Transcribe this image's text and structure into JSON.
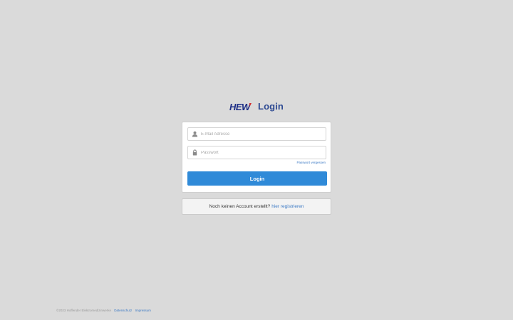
{
  "header": {
    "logo_text": "HEW",
    "title": "Login"
  },
  "login_form": {
    "email": {
      "placeholder": "E-Mail Adresse",
      "value": "",
      "icon": "user-icon"
    },
    "password": {
      "placeholder": "Passwort",
      "value": "",
      "icon": "lock-icon"
    },
    "forgot_link": "Passwort vergessen",
    "submit_label": "Login"
  },
  "register": {
    "prompt": "Noch keinen Account erstellt?",
    "link": "hier registrieren"
  },
  "footer": {
    "copyright": "©2023 Hoffender Elektromedizinwerke",
    "privacy_link": "Datenschutz",
    "imprint_link": "Impressum"
  },
  "colors": {
    "background": "#dadada",
    "primary": "#2f8ad8",
    "link": "#3b79c4",
    "title": "#2f4b93",
    "logo_blue": "#1e2f86",
    "logo_red": "#d42a2a"
  }
}
